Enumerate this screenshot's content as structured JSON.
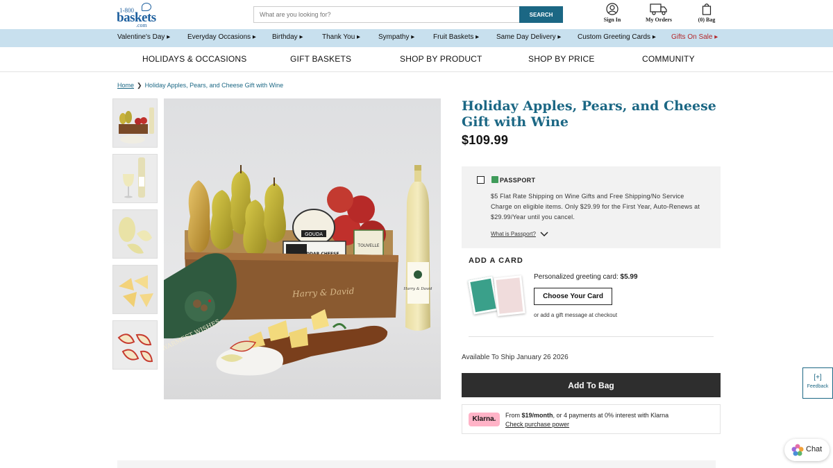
{
  "header": {
    "logo": {
      "prefix": "1-800",
      "name": "baskets",
      "domain": ".com"
    },
    "search_placeholder": "What are you looking for?",
    "search_button": "SEARCH",
    "sign_in": "Sign In",
    "my_orders": "My Orders",
    "bag": "(0) Bag"
  },
  "category_nav": [
    "Valentine's Day ▸",
    "Everyday Occasions ▸",
    "Birthday ▸",
    "Thank You ▸",
    "Sympathy ▸",
    "Fruit Baskets ▸",
    "Same Day Delivery ▸",
    "Custom Greeting Cards ▸",
    "Gifts On Sale ▸"
  ],
  "main_nav": [
    "HOLIDAYS & OCCASIONS",
    "GIFT BASKETS",
    "SHOP BY PRODUCT",
    "SHOP BY PRICE",
    "COMMUNITY"
  ],
  "breadcrumb": {
    "home": "Home",
    "separator": "❯",
    "current": "Holiday Apples, Pears, and Cheese Gift with Wine"
  },
  "product": {
    "title": "Holiday Apples, Pears, and Cheese Gift with Wine",
    "price": "$109.99",
    "image_labels": {
      "cheese1": "GOUDA",
      "cheese2": "CHEDDAR CHEESE",
      "cheese3": "TOUVELLE",
      "tag": "WARMEST WISHES",
      "wine_brand": "Harry & David",
      "crate_brand": "Harry & David"
    }
  },
  "passport": {
    "name": "PASSPORT",
    "description": "$5 Flat Rate Shipping on Wine Gifts and Free Shipping/No Service Charge on eligible items. Only $29.99 for the First Year, Auto-Renews at $29.99/Year until you cancel.",
    "what_is": "What is Passport?"
  },
  "greeting_card": {
    "section_title": "ADD A CARD",
    "label": "Personalized greeting card:",
    "price": "$5.99",
    "button": "Choose Your Card",
    "alt_text": "or add a gift message at checkout"
  },
  "availability": "Available To Ship January 26 2026",
  "add_to_bag": "Add To Bag",
  "klarna": {
    "logo": "Klarna.",
    "text_prefix": "From ",
    "amount": "$19/month",
    "text_suffix": ", or 4 payments at 0% interest with Klarna",
    "link": "Check purchase power"
  },
  "feedback": {
    "icon": "[+]",
    "label": "Feedback"
  },
  "chat": "Chat",
  "colors": {
    "brand_blue": "#1b6784",
    "nav_bg": "#c8e0ee",
    "sale_red": "#b3262a",
    "klarna_pink": "#ffb3c7"
  }
}
